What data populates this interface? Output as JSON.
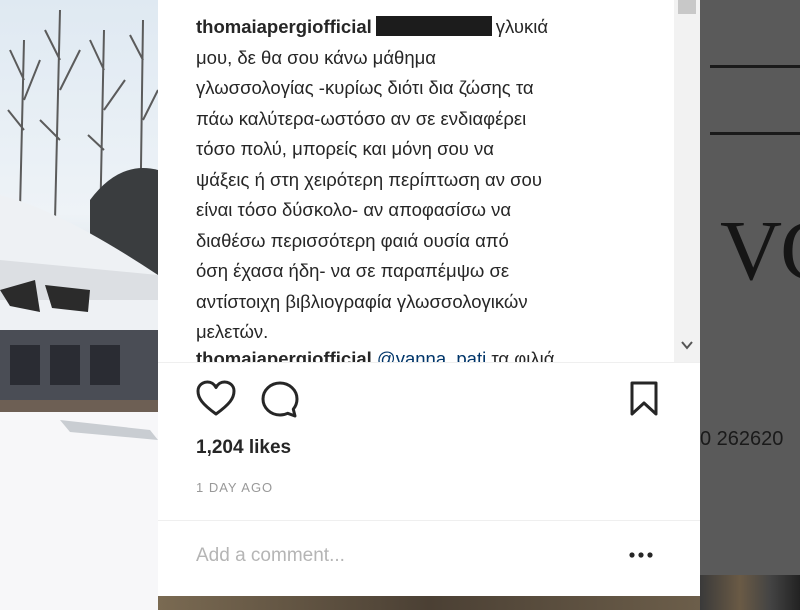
{
  "post": {
    "comments": [
      {
        "username": "thomaiapergiofficial",
        "mention_redacted": true,
        "first_line_tail": "γλυκιά",
        "lines": [
          "μου, δε θα σου κάνω μάθημα",
          "γλωσσολογίας -κυρίως διότι δια ζώσης τα",
          "πάω καλύτερα-ωστόσο αν σε ενδιαφέρει",
          "τόσο πολύ, μπορείς και μόνη σου να",
          "ψάξεις ή στη χειρότερη περίπτωση αν σου",
          "είναι τόσο δύσκολο- αν αποφασίσω να",
          "διαθέσω περισσότερη φαιά ουσία από",
          "όση έχασα ήδη- να σε παραπέμψω σε",
          "αντίστοιχη βιβλιογραφία γλωσσολογικών",
          "μελετών."
        ]
      },
      {
        "username": "thomaiapergiofficial",
        "mention": "@vanna_pati",
        "text": "τα φιλιά"
      }
    ],
    "likes": "1,204 likes",
    "time": "1 DAY AGO",
    "comment_placeholder": "Add a comment...",
    "icons": {
      "like": "heart-icon",
      "comment": "comment-bubble-icon",
      "save": "bookmark-icon",
      "more": "more-options-icon",
      "scroll_down": "chevron-down-icon"
    }
  },
  "background": {
    "big_text": "VC",
    "phone_fragment": "0 262620"
  },
  "colors": {
    "text": "#262626",
    "mention": "#003569",
    "muted": "#999999",
    "placeholder": "#b5b5b5"
  }
}
